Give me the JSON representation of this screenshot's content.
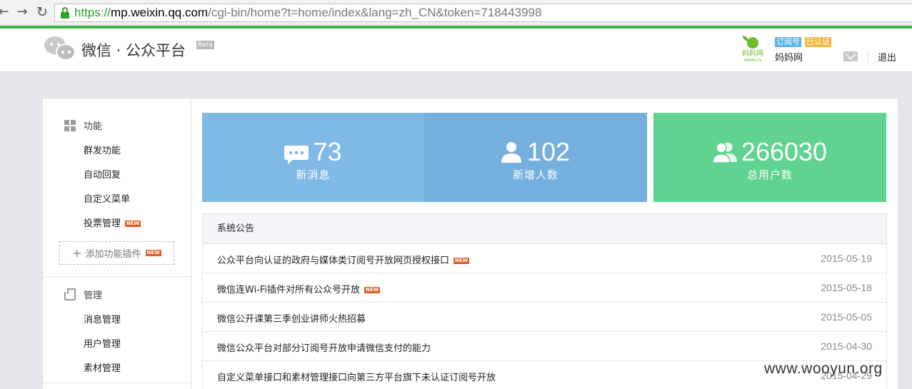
{
  "browser": {
    "url_scheme": "https://",
    "url_host": "mp.weixin.qq.com",
    "url_rest": "/cgi-bin/home?t=home/index&lang=zh_CN&token=718443998"
  },
  "header": {
    "brand": "微信 · 公众平台",
    "beta": "Beta",
    "avatar_text": "妈妈网",
    "avatar_subtext": "MAMA.CN",
    "badge_type": "订阅号",
    "badge_verified": "已认证",
    "account_name": "妈妈网",
    "logout": "退出"
  },
  "sidebar": {
    "section_func": "功能",
    "func_items": [
      {
        "label": "群发功能"
      },
      {
        "label": "自动回复"
      },
      {
        "label": "自定义菜单"
      },
      {
        "label": "投票管理",
        "new": "NEW"
      }
    ],
    "add_plugin": "添加功能插件",
    "add_plugin_new": "NEW",
    "section_manage": "管理",
    "manage_items": [
      {
        "label": "消息管理"
      },
      {
        "label": "用户管理"
      },
      {
        "label": "素材管理"
      }
    ]
  },
  "stats": [
    {
      "value": "73",
      "label": "新消息"
    },
    {
      "value": "102",
      "label": "新增人数"
    },
    {
      "value": "266030",
      "label": "总用户数"
    }
  ],
  "notices": {
    "title": "系统公告",
    "items": [
      {
        "title": "公众平台向认证的政府与媒体类订阅号开放网页授权接口",
        "new": "NEW",
        "date": "2015-05-19"
      },
      {
        "title": "微信连Wi-Fi插件对所有公众号开放",
        "new": "NEW",
        "date": "2015-05-18"
      },
      {
        "title": "微信公开课第三季创业讲师火热招募",
        "date": "2015-05-05"
      },
      {
        "title": "微信公众平台对部分订阅号开放申请微信支付的能力",
        "date": "2015-04-30"
      },
      {
        "title": "自定义菜单接口和素材管理接口向第三方平台旗下未认证订阅号开放",
        "date": "2015-04-29"
      }
    ]
  },
  "watermark": "www.wooyun.org"
}
